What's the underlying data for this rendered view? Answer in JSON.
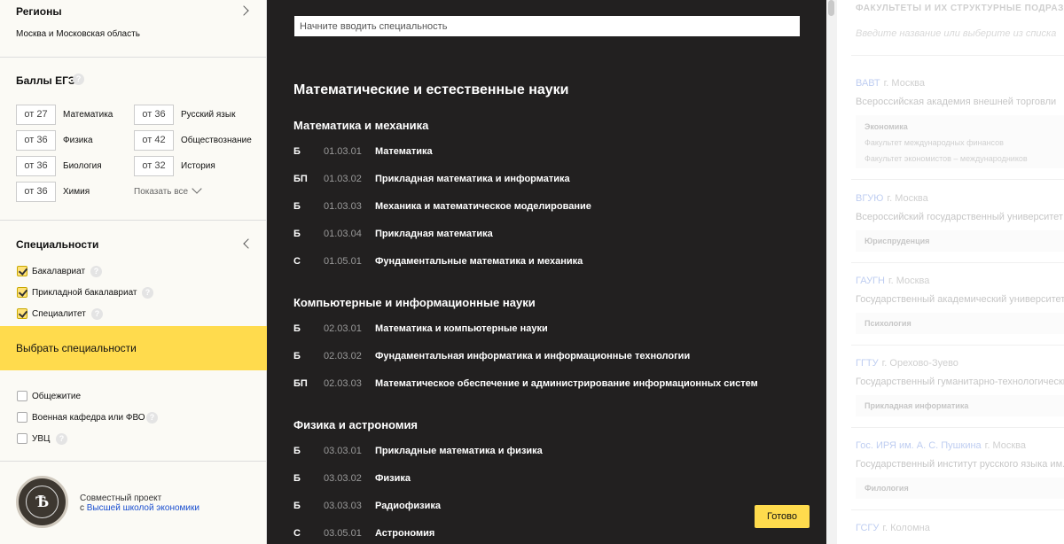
{
  "sidebar": {
    "regions": {
      "title": "Регионы",
      "value": "Москва и Московская область"
    },
    "ege": {
      "title": "Баллы ЕГЭ",
      "help": "?",
      "scores": [
        {
          "value": "от 27",
          "subject": "Математика"
        },
        {
          "value": "от 36",
          "subject": "Русский язык"
        },
        {
          "value": "от 36",
          "subject": "Физика"
        },
        {
          "value": "от 42",
          "subject": "Обществознание"
        },
        {
          "value": "от 36",
          "subject": "Биология"
        },
        {
          "value": "от 32",
          "subject": "История"
        },
        {
          "value": "от 36",
          "subject": "Химия"
        }
      ],
      "show_all": "Показать все"
    },
    "specialties": {
      "title": "Специальности",
      "options": [
        {
          "label": "Бакалавриат",
          "checked": true
        },
        {
          "label": "Прикладной бакалавриат",
          "checked": true
        },
        {
          "label": "Специалитет",
          "checked": true
        }
      ],
      "choose_button": "Выбрать специальности"
    },
    "extras": [
      {
        "label": "Общежитие",
        "checked": false,
        "help": false
      },
      {
        "label": "Военная кафедра или ФВО",
        "checked": false,
        "help": true
      },
      {
        "label": "УВЦ",
        "checked": false,
        "help": true
      }
    ],
    "footer": {
      "logo_text": "Ѣ",
      "text_line1": "Совместный проект",
      "text_prefix": "с",
      "link": "Высшей школой экономики"
    },
    "colors": {
      "accent": "#ffdb4d",
      "link": "#1a4fd0"
    }
  },
  "middle": {
    "search_placeholder": "Начните вводить специальность",
    "area_title": "Математические и естественные науки",
    "groups": [
      {
        "title": "Математика и механика",
        "items": [
          {
            "level": "Б",
            "code": "01.03.01",
            "name": "Математика"
          },
          {
            "level": "БП",
            "code": "01.03.02",
            "name": "Прикладная математика и информатика"
          },
          {
            "level": "Б",
            "code": "01.03.03",
            "name": "Механика и математическое моделирование"
          },
          {
            "level": "Б",
            "code": "01.03.04",
            "name": "Прикладная математика"
          },
          {
            "level": "С",
            "code": "01.05.01",
            "name": "Фундаментальные математика и механика"
          }
        ]
      },
      {
        "title": "Компьютерные и информационные науки",
        "items": [
          {
            "level": "Б",
            "code": "02.03.01",
            "name": "Математика и компьютерные науки"
          },
          {
            "level": "Б",
            "code": "02.03.02",
            "name": "Фундаментальная информатика и информационные технологии"
          },
          {
            "level": "БП",
            "code": "02.03.03",
            "name": "Математическое обеспечение и администрирование информационных систем"
          }
        ]
      },
      {
        "title": "Физика и астрономия",
        "items": [
          {
            "level": "Б",
            "code": "03.03.01",
            "name": "Прикладные математика и физика"
          },
          {
            "level": "Б",
            "code": "03.03.02",
            "name": "Физика"
          },
          {
            "level": "Б",
            "code": "03.03.03",
            "name": "Радиофизика"
          },
          {
            "level": "С",
            "code": "03.05.01",
            "name": "Астрономия"
          }
        ]
      }
    ],
    "done_button": "Готово"
  },
  "right": {
    "header": "ФАКУЛЬТЕТЫ И ИХ СТРУКТУРНЫЕ ПОДРАЗДЕЛЕНИЯ",
    "search_placeholder": "Введите название или выберите из списка",
    "universities": [
      {
        "abbr": "ВАВТ",
        "city": "г. Москва",
        "full": "Всероссийская академия внешней торговли",
        "faculties": [
          "Экономика",
          "Факультет международных финансов",
          "Факультет экономистов – международников"
        ]
      },
      {
        "abbr": "ВГУЮ",
        "city": "г. Москва",
        "full": "Всероссийский государственный университет юстиции",
        "faculties": [
          "Юриспруденция"
        ]
      },
      {
        "abbr": "ГАУГН",
        "city": "г. Москва",
        "full": "Государственный академический университет гуманитарных наук",
        "faculties": [
          "Психология"
        ]
      },
      {
        "abbr": "ГГТУ",
        "city": "г. Орехово-Зуево",
        "full": "Государственный гуманитарно-технологический университет",
        "faculties": [
          "Прикладная информатика"
        ]
      },
      {
        "abbr": "Гос. ИРЯ им. А. С. Пушкина",
        "city": "г. Москва",
        "full": "Государственный институт русского языка им. А. С. Пушкина",
        "faculties": [
          "Филология"
        ]
      },
      {
        "abbr": "ГСГУ",
        "city": "г. Коломна",
        "full": "",
        "faculties": []
      }
    ]
  }
}
